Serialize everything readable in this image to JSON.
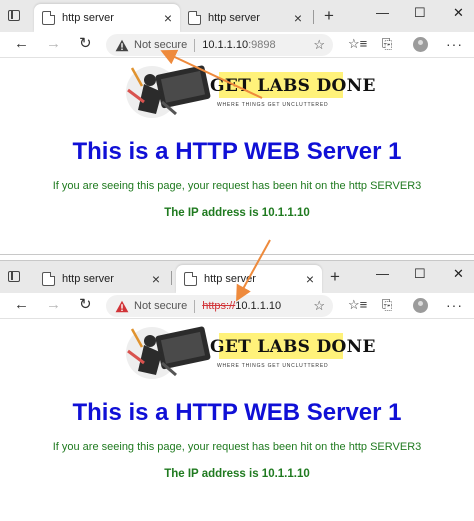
{
  "colors": {
    "heading": "#1010d6",
    "body_text": "#1f7a1f",
    "logo_highlight": "#fff27a",
    "arrow": "#ee8a3c",
    "warning": "#d13438"
  },
  "windows": [
    {
      "tabs": [
        {
          "title": "http server",
          "active": true,
          "close": "×"
        },
        {
          "title": "http server",
          "active": false,
          "close": "×"
        }
      ],
      "new_tab": "+",
      "window_controls": {
        "minimize": "—",
        "maximize": "☐",
        "close": "✕"
      },
      "toolbar": {
        "back": "←",
        "forward": "→",
        "refresh": "↻",
        "security_label": "Not secure",
        "url": {
          "scheme": "",
          "host": "10.1.1.10",
          "port": ":9898"
        },
        "favorite_icon": "☆",
        "collections_icon": "⎘",
        "more_icon": "···"
      },
      "page": {
        "logo_title": "GET LABS DONE",
        "logo_tagline": "WHERE THINGS GET UNCLUTTERED",
        "heading": "This is a HTTP WEB Server 1",
        "subtext": "If you are seeing this page, your request has been hit on the http SERVER3",
        "ip_line": "The IP address is 10.1.1.10"
      }
    },
    {
      "tabs": [
        {
          "title": "http server",
          "active": false,
          "close": "×"
        },
        {
          "title": "http server",
          "active": true,
          "close": "×"
        }
      ],
      "new_tab": "+",
      "window_controls": {
        "minimize": "—",
        "maximize": "☐",
        "close": "✕"
      },
      "toolbar": {
        "back": "←",
        "forward": "→",
        "refresh": "↻",
        "security_label": "Not secure",
        "url": {
          "scheme": "https://",
          "host": "10.1.1.10",
          "port": ""
        },
        "favorite_icon": "☆",
        "collections_icon": "⎘",
        "more_icon": "···"
      },
      "page": {
        "logo_title": "GET LABS DONE",
        "logo_tagline": "WHERE THINGS GET UNCLUTTERED",
        "heading": "This is a HTTP WEB Server 1",
        "subtext": "If you are seeing this page, your request has been hit on the http SERVER3",
        "ip_line": "The IP address is 10.1.1.10"
      }
    }
  ]
}
